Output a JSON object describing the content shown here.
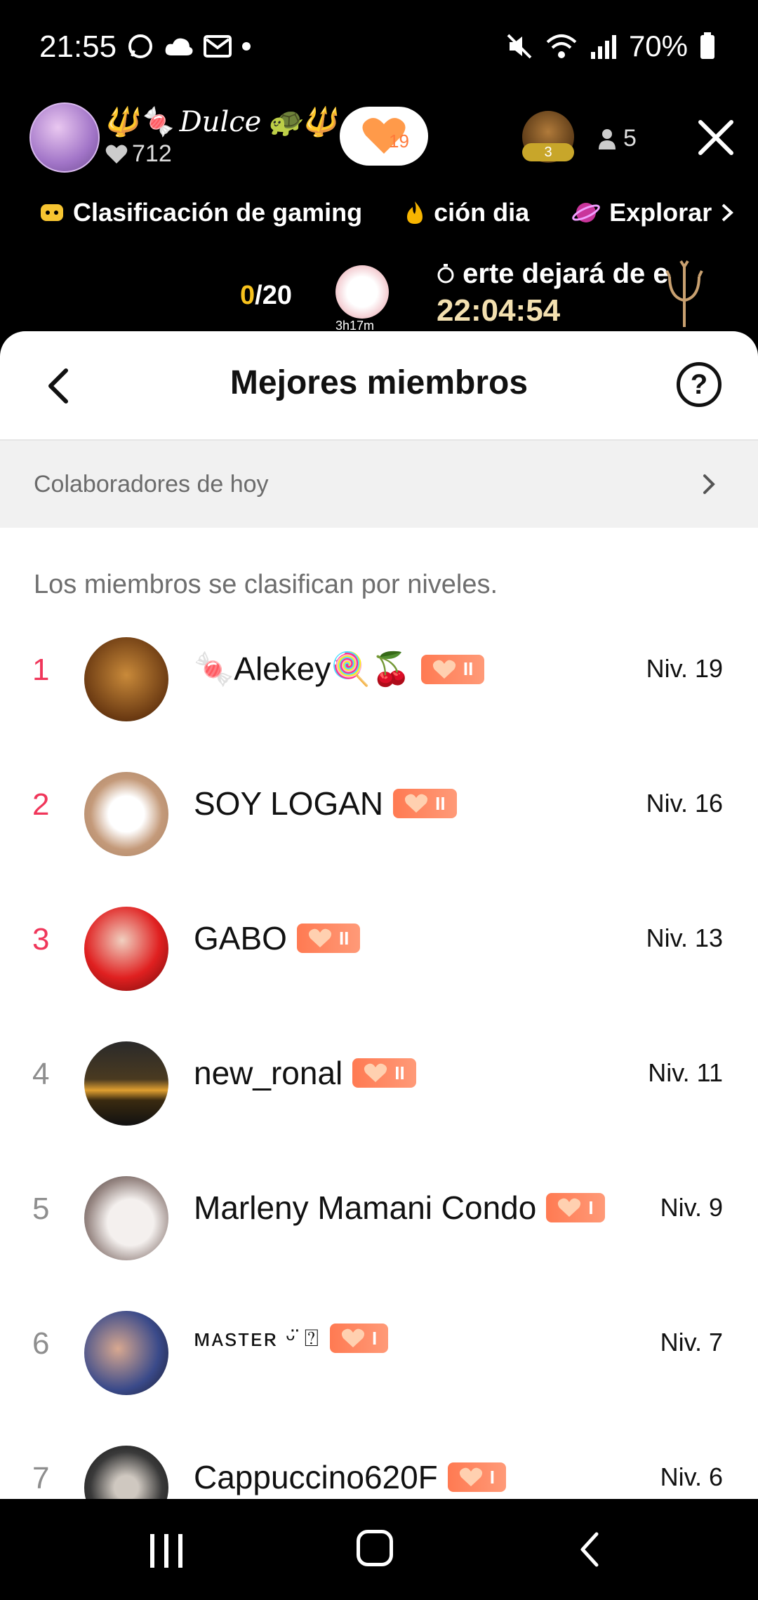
{
  "status_bar": {
    "time": "21:55",
    "battery": "70%"
  },
  "live": {
    "host_name": "Dulce",
    "host_name_decor_left": "🔱🍬",
    "host_name_decor_right": "🐢🔱",
    "host_likes": "712",
    "fan_level": "19",
    "viewer_badge": "3",
    "viewer_count": "5",
    "chips": [
      {
        "label": "Clasificación de gaming",
        "icon": "gamepad-icon"
      },
      {
        "label": "ción dia",
        "icon": "fire-icon"
      },
      {
        "label": "Explorar",
        "icon": "planet-icon"
      }
    ],
    "counter_current": "0",
    "counter_total": "/20",
    "paw_time": "3h17m",
    "timer_label": "erte dejará de e",
    "timer_value": "22:04:54"
  },
  "sheet": {
    "title": "Mejores miembros",
    "collaborators_label": "Colaboradores de hoy",
    "note": "Los miembros se clasifican por niveles.",
    "members": [
      {
        "rank": "1",
        "name": "🍬Alekey🍭🍒",
        "badge": "II",
        "level": "Niv. 19"
      },
      {
        "rank": "2",
        "name": "SOY LOGAN",
        "badge": "II",
        "level": "Niv. 16"
      },
      {
        "rank": "3",
        "name": "GABO",
        "badge": "II",
        "level": "Niv. 13"
      },
      {
        "rank": "4",
        "name": "new_ronal",
        "badge": "II",
        "level": "Niv. 11"
      },
      {
        "rank": "5",
        "name": "Marleny Mamani Condo",
        "badge": "I",
        "level": "Niv. 9"
      },
      {
        "rank": "6",
        "name": "ᴍᴀsᴛᴇʀ ᵕ̈ ⍰",
        "badge": "I",
        "level": "Niv. 7"
      },
      {
        "rank": "7",
        "name": "Cappuccino620F",
        "badge": "I",
        "level": "Niv. 6"
      }
    ]
  }
}
